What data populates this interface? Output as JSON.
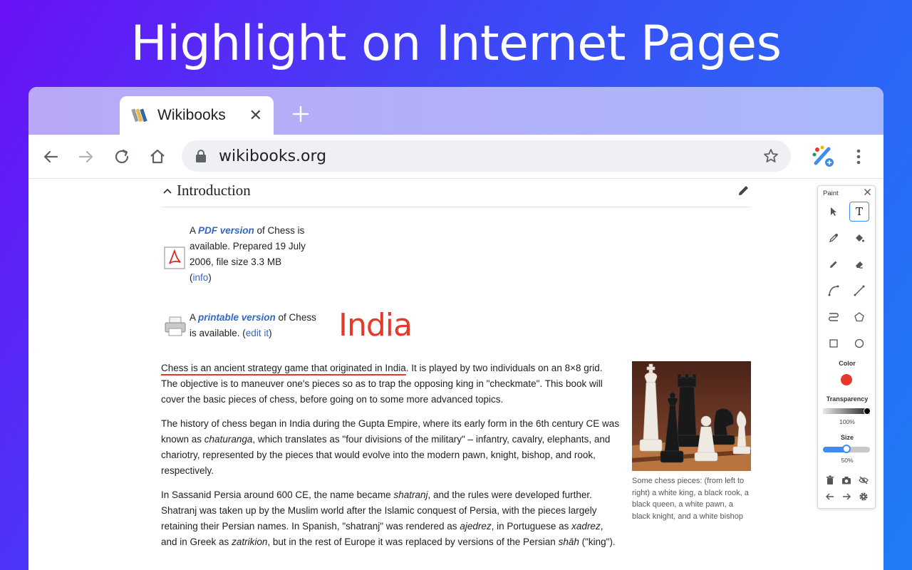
{
  "headline": "Highlight on Internet Pages",
  "tab": {
    "title": "Wikibooks",
    "close": "✕"
  },
  "omnibox": {
    "url": "wikibooks.org"
  },
  "section": {
    "title": "Introduction"
  },
  "pdf": {
    "pre": "A ",
    "link": "PDF version",
    "post": " of Chess is available. Prepared 19 July 2006, file size 3.3 MB",
    "paren_open": "(",
    "info": "info",
    "paren_close": ")"
  },
  "printable": {
    "pre": "A ",
    "link": "printable version",
    "post": " of Chess is available. (",
    "edit": "edit it",
    "close": ")"
  },
  "annotation": {
    "text": "India",
    "color": "#e53a2b"
  },
  "paragraphs": {
    "p1_underlined": "Chess is an ancient strategy game that originated in India",
    "p1_rest": ". It is played by two individuals on an 8×8 grid. The objective is to maneuver one's pieces so as to trap the opposing king in \"checkmate\". This book will cover the basic pieces of chess, before going on to some more advanced topics.",
    "p2_a": "The history of chess began in India during the Gupta Empire, where its early form in the 6th century CE was known as ",
    "p2_em": "chaturanga",
    "p2_b": ", which translates as \"four divisions of the military\" – infantry, cavalry, elephants, and chariotry, represented by the pieces that would evolve into the modern pawn, knight, bishop, and rook, respectively.",
    "p3_a": "In Sassanid Persia around 600 CE, the name became ",
    "p3_em1": "shatranj",
    "p3_b": ", and the rules were developed further. Shatranj was taken up by the Muslim world after the Islamic conquest of Persia, with the pieces largely retaining their Persian names. In Spanish, \"shatranj\" was rendered as ",
    "p3_em2": "ajedrez",
    "p3_c": ", in Portuguese as ",
    "p3_em3": "xadrez",
    "p3_d": ", and in Greek as ",
    "p3_em4": "zatrikion",
    "p3_e": ", but in the rest of Europe it was replaced by versions of the Persian ",
    "p3_em5": "shāh",
    "p3_f": " (\"king\")."
  },
  "figure": {
    "caption": "Some chess pieces: (from left to right) a white king, a black rook, a black queen, a white pawn, a black knight, and a white bishop"
  },
  "paint": {
    "title": "Paint",
    "text_tool": "T",
    "color_label": "Color",
    "transparency_label": "Transparency",
    "transparency_value": "100%",
    "transparency_level": 1.0,
    "size_label": "Size",
    "size_value": "50%",
    "size_level": 0.5,
    "accent": "#3f8cf0"
  }
}
